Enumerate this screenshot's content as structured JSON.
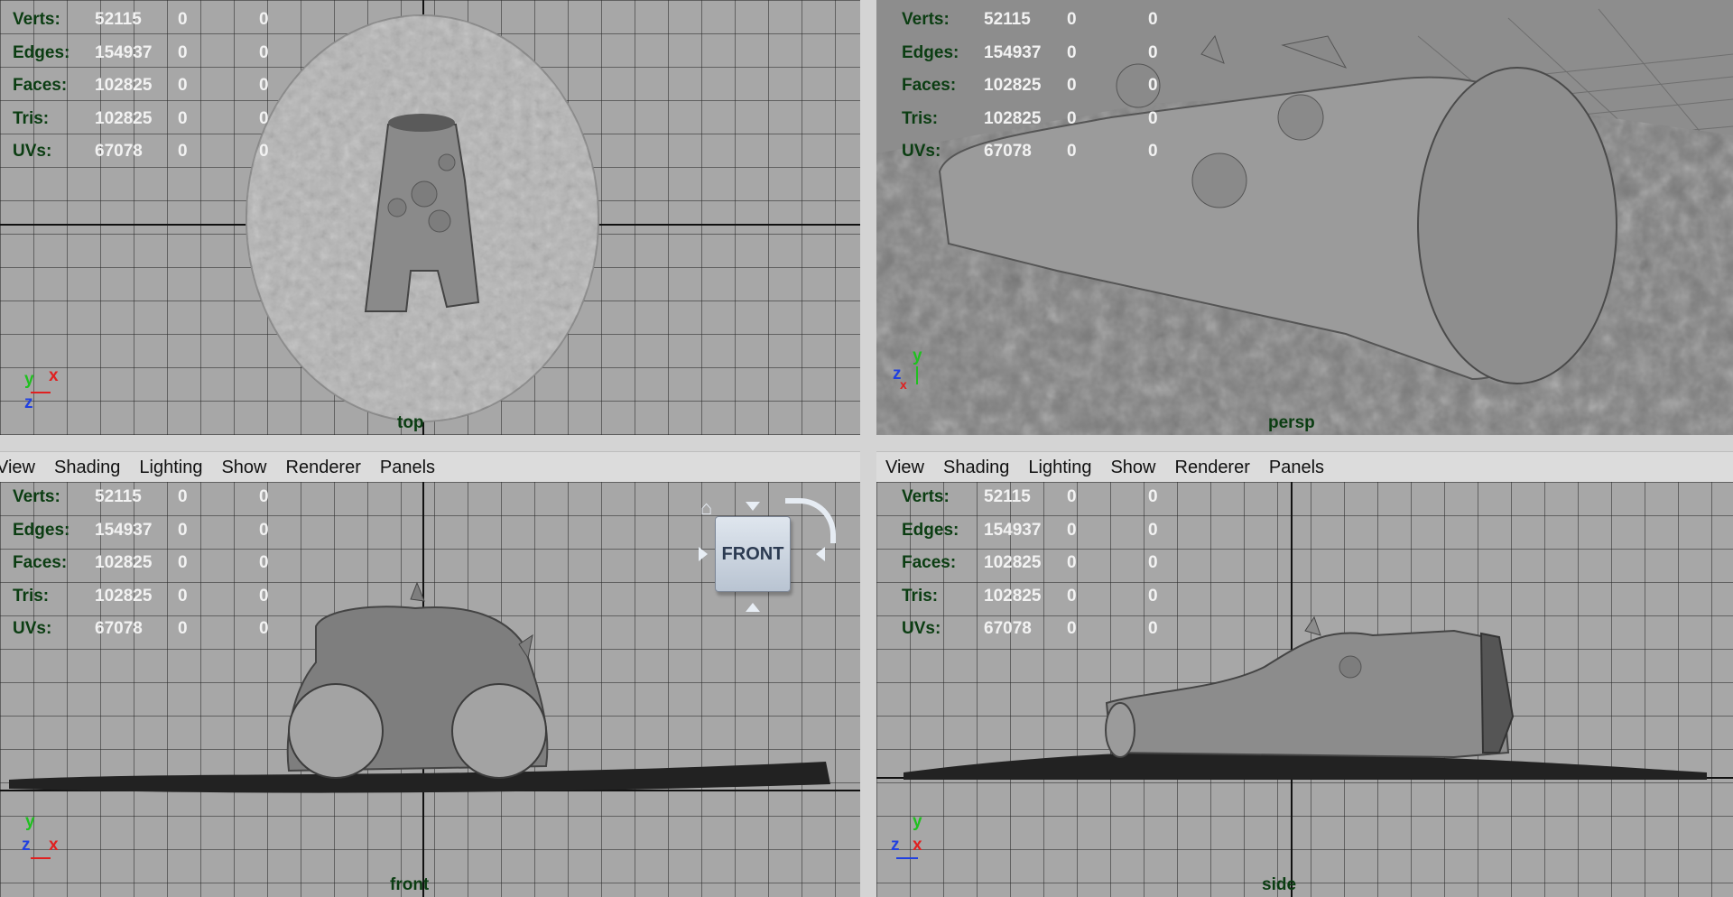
{
  "hud_labels": [
    "Verts:",
    "Edges:",
    "Faces:",
    "Tris:",
    "UVs:"
  ],
  "viewports": {
    "top": {
      "camera": "top",
      "stats": [
        [
          "52115",
          "0",
          "0"
        ],
        [
          "154937",
          "0",
          "0"
        ],
        [
          "102825",
          "0",
          "0"
        ],
        [
          "102825",
          "0",
          "0"
        ],
        [
          "67078",
          "0",
          "0"
        ]
      ]
    },
    "persp": {
      "camera": "persp",
      "stats": [
        [
          "52115",
          "0",
          "0"
        ],
        [
          "154937",
          "0",
          "0"
        ],
        [
          "102825",
          "0",
          "0"
        ],
        [
          "102825",
          "0",
          "0"
        ],
        [
          "67078",
          "0",
          "0"
        ]
      ]
    },
    "front": {
      "camera": "front",
      "stats": [
        [
          "52115",
          "0",
          "0"
        ],
        [
          "154937",
          "0",
          "0"
        ],
        [
          "102825",
          "0",
          "0"
        ],
        [
          "102825",
          "0",
          "0"
        ],
        [
          "67078",
          "0",
          "0"
        ]
      ]
    },
    "side": {
      "camera": "side",
      "stats": [
        [
          "52115",
          "0",
          "0"
        ],
        [
          "154937",
          "0",
          "0"
        ],
        [
          "102825",
          "0",
          "0"
        ],
        [
          "102825",
          "0",
          "0"
        ],
        [
          "67078",
          "0",
          "0"
        ]
      ]
    }
  },
  "panel_menu": [
    "View",
    "Shading",
    "Lighting",
    "Show",
    "Renderer",
    "Panels"
  ],
  "viewcube": {
    "face_label": "FRONT"
  },
  "axis_gizmo": {
    "x": "x",
    "y": "y",
    "z": "z"
  },
  "colors": {
    "viewport_bg": "#a7a7a7",
    "hud_label": "#0b3d12",
    "hud_value": "#f2f2f2",
    "axis_x": "#e02020",
    "axis_y": "#20c020",
    "axis_z": "#2040e0"
  }
}
